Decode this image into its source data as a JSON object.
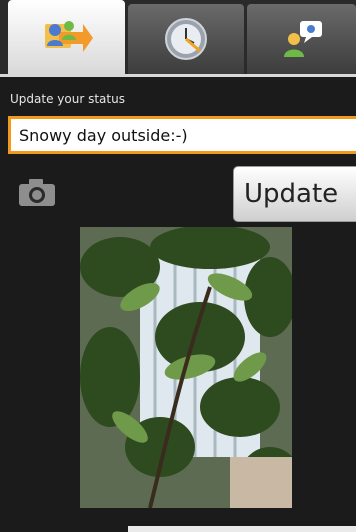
{
  "tabs": [
    {
      "icon": "contacts-share-icon",
      "selected": true
    },
    {
      "icon": "clock-icon",
      "selected": false
    },
    {
      "icon": "chat-people-icon",
      "selected": false
    }
  ],
  "status": {
    "label": "Update your status",
    "value": "Snowy day outside:-)"
  },
  "camera": {
    "icon": "camera-icon"
  },
  "update_button": {
    "label": "Update"
  },
  "colors": {
    "background": "#1b1b1b",
    "input_focus_border": "#f29a1d",
    "tab_selected": "#ffffff"
  }
}
